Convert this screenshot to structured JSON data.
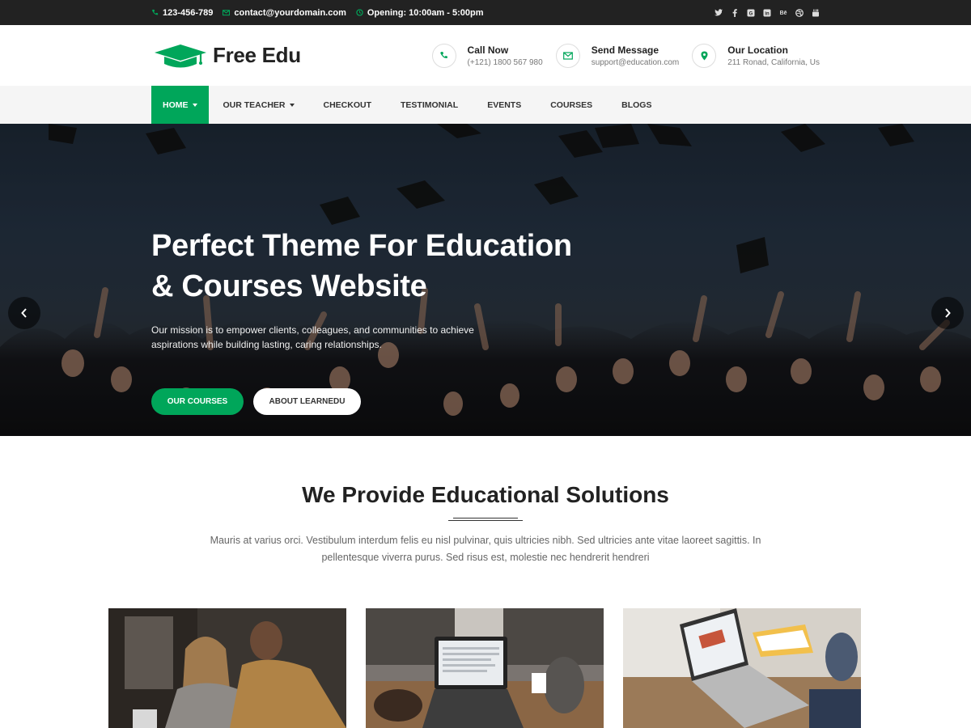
{
  "topbar": {
    "phone": "123-456-789",
    "email": "contact@yourdomain.com",
    "opening": "Opening: 10:00am - 5:00pm",
    "social": [
      "twitter-icon",
      "facebook-icon",
      "google-plus-icon",
      "linkedin-icon",
      "behance-icon",
      "dribbble-icon",
      "youtube-icon"
    ]
  },
  "header": {
    "logo_text": "Free Edu",
    "contacts": [
      {
        "icon": "phone-icon",
        "title": "Call Now",
        "sub": "(+121) 1800 567 980"
      },
      {
        "icon": "envelope-icon",
        "title": "Send Message",
        "sub": "support@education.com"
      },
      {
        "icon": "location-pin-icon",
        "title": "Our Location",
        "sub": "211 Ronad, California, Us"
      }
    ]
  },
  "nav": {
    "items": [
      {
        "label": "HOME",
        "dropdown": true,
        "active": true
      },
      {
        "label": "OUR TEACHER",
        "dropdown": true,
        "active": false
      },
      {
        "label": "CHECKOUT",
        "dropdown": false,
        "active": false
      },
      {
        "label": "TESTIMONIAL",
        "dropdown": false,
        "active": false
      },
      {
        "label": "EVENTS",
        "dropdown": false,
        "active": false
      },
      {
        "label": "COURSES",
        "dropdown": false,
        "active": false
      },
      {
        "label": "BLOGS",
        "dropdown": false,
        "active": false
      }
    ]
  },
  "hero": {
    "title_line1": "Perfect Theme For Education",
    "title_line2": "& Courses Website",
    "text": "Our mission is to empower clients, colleagues, and communities to achieve aspirations while building lasting, caring relationships.",
    "btn_primary": "OUR COURSES",
    "btn_secondary": "ABOUT LEARNEDU"
  },
  "section": {
    "title": "We Provide Educational Solutions",
    "text": "Mauris at varius orci. Vestibulum interdum felis eu nisl pulvinar, quis ultricies nibh. Sed ultricies ante vitae laoreet sagittis. In pellentesque viverra purus. Sed risus est, molestie nec hendrerit hendreri"
  },
  "colors": {
    "accent": "#00a65a",
    "topbar": "#222222",
    "nav_bg": "#f5f5f5"
  }
}
